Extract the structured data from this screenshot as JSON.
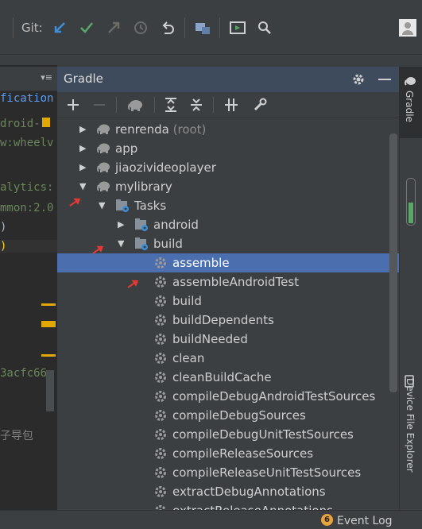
{
  "toolbar": {
    "git_label": "Git:"
  },
  "editor": {
    "tab_menu": "▾≡",
    "lines": [
      {
        "text": "fication",
        "color": "#589df6"
      },
      {
        "text": "droid-",
        "color": "#6a8759"
      },
      {
        "text": "w:wheelv",
        "color": "#6a8759"
      },
      {
        "text": "alytics:",
        "color": "#6a8759"
      },
      {
        "text": "mmon:2.0",
        "color": "#6a8759"
      },
      {
        "text": ")",
        "color": "#a9b7c6"
      },
      {
        "text": ")",
        "color": "#ffd500"
      },
      {
        "text": "3acfc66",
        "color": "#6a8759"
      },
      {
        "text": "子导包",
        "color": "#808080"
      }
    ]
  },
  "gradle": {
    "title": "Gradle",
    "tree": [
      {
        "label": "renrenda",
        "suffix": " (root)",
        "level": 0,
        "arrow": "▶",
        "icon": "elephant-icon"
      },
      {
        "label": "app",
        "suffix": "",
        "level": 0,
        "arrow": "▶",
        "icon": "elephant-icon"
      },
      {
        "label": "jiaozivideoplayer",
        "suffix": "",
        "level": 0,
        "arrow": "▶",
        "icon": "elephant-icon"
      },
      {
        "label": "mylibrary",
        "suffix": "",
        "level": 0,
        "arrow": "▼",
        "icon": "elephant-icon"
      },
      {
        "label": "Tasks",
        "suffix": "",
        "level": 1,
        "arrow": "▼",
        "icon": "folder-gear-icon"
      },
      {
        "label": "android",
        "suffix": "",
        "level": 2,
        "arrow": "▶",
        "icon": "folder-gear-icon"
      },
      {
        "label": "build",
        "suffix": "",
        "level": 2,
        "arrow": "▼",
        "icon": "folder-gear-icon"
      },
      {
        "label": "assemble",
        "suffix": "",
        "level": 3,
        "arrow": "",
        "icon": "gear-icon",
        "selected": true
      },
      {
        "label": "assembleAndroidTest",
        "suffix": "",
        "level": 3,
        "arrow": "",
        "icon": "gear-icon"
      },
      {
        "label": "build",
        "suffix": "",
        "level": 3,
        "arrow": "",
        "icon": "gear-icon"
      },
      {
        "label": "buildDependents",
        "suffix": "",
        "level": 3,
        "arrow": "",
        "icon": "gear-icon"
      },
      {
        "label": "buildNeeded",
        "suffix": "",
        "level": 3,
        "arrow": "",
        "icon": "gear-icon"
      },
      {
        "label": "clean",
        "suffix": "",
        "level": 3,
        "arrow": "",
        "icon": "gear-icon"
      },
      {
        "label": "cleanBuildCache",
        "suffix": "",
        "level": 3,
        "arrow": "",
        "icon": "gear-icon"
      },
      {
        "label": "compileDebugAndroidTestSources",
        "suffix": "",
        "level": 3,
        "arrow": "",
        "icon": "gear-icon"
      },
      {
        "label": "compileDebugSources",
        "suffix": "",
        "level": 3,
        "arrow": "",
        "icon": "gear-icon"
      },
      {
        "label": "compileDebugUnitTestSources",
        "suffix": "",
        "level": 3,
        "arrow": "",
        "icon": "gear-icon"
      },
      {
        "label": "compileReleaseSources",
        "suffix": "",
        "level": 3,
        "arrow": "",
        "icon": "gear-icon"
      },
      {
        "label": "compileReleaseUnitTestSources",
        "suffix": "",
        "level": 3,
        "arrow": "",
        "icon": "gear-icon"
      },
      {
        "label": "extractDebugAnnotations",
        "suffix": "",
        "level": 3,
        "arrow": "",
        "icon": "gear-icon"
      },
      {
        "label": "extractReleaseAnnotations",
        "suffix": "",
        "level": 3,
        "arrow": "",
        "icon": "gear-icon"
      }
    ]
  },
  "right_strip": {
    "gradle_tab": "Gradle",
    "device_explorer_tab": "Device File Explorer"
  },
  "status": {
    "event_count": "6",
    "event_log": "Event Log"
  },
  "colors": {
    "selection": "#4b6eaf",
    "panel_header": "#3d4b5c",
    "background": "#3c3f41"
  }
}
